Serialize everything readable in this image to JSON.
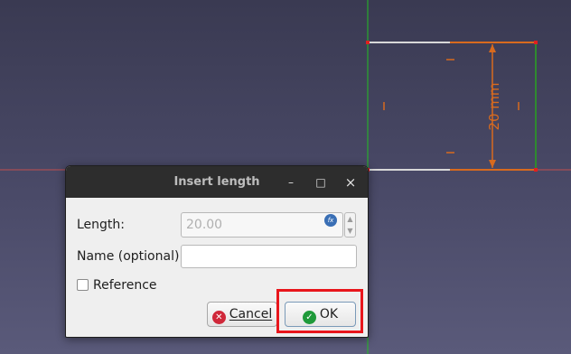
{
  "viewport": {
    "dimension_label": "20 mm",
    "colors": {
      "dimension": "#d86a1e",
      "axis_x": "#c24f4f",
      "axis_y": "#22c022",
      "vertex": "#e02020"
    }
  },
  "dialog": {
    "title": "Insert length",
    "window_buttons": {
      "minimize": "–",
      "maximize": "□",
      "close": "×"
    },
    "length_label": "Length:",
    "length_value": "20.00",
    "name_label": "Name (optional)",
    "name_value": "",
    "reference_label": "Reference",
    "reference_checked": false,
    "cancel_label": "Cancel",
    "ok_label": "OK",
    "expression_icon": "fx-icon"
  }
}
